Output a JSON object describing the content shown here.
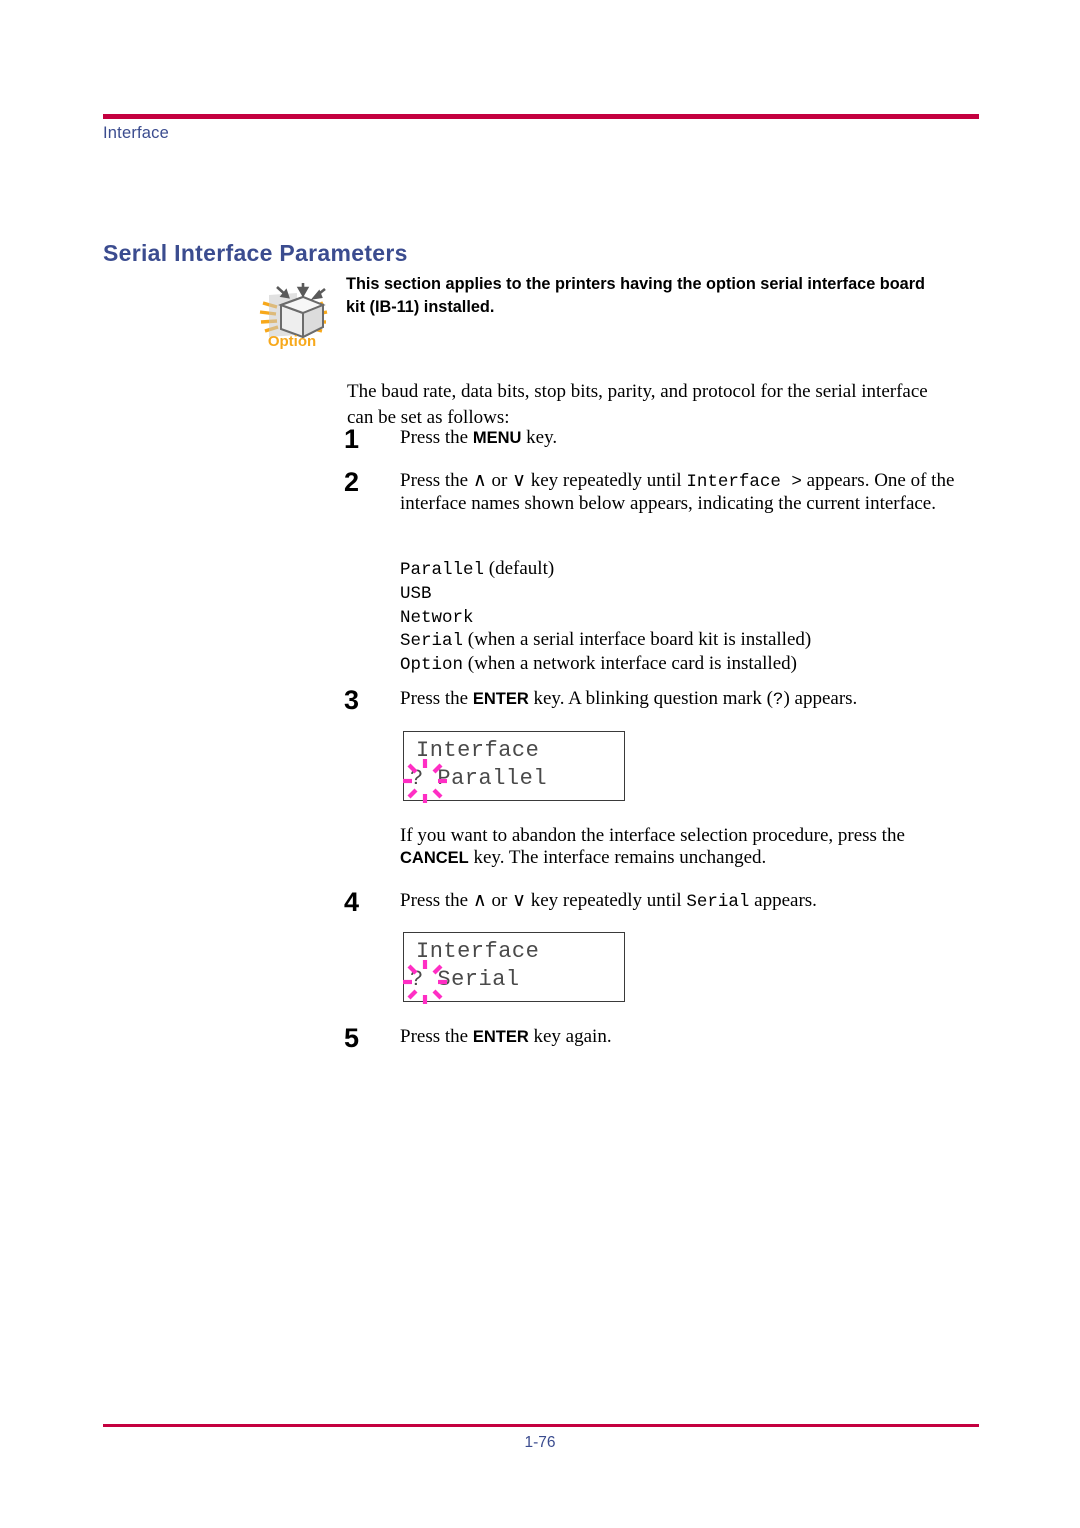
{
  "header": {
    "section_label": "Interface",
    "rule_color": "#C4003F",
    "label_color": "#3B4C8F"
  },
  "title": {
    "text": "Serial Interface Parameters",
    "color": "#3B4C8F"
  },
  "option_note": {
    "icon_name": "option-box-icon",
    "caption": "Option",
    "caption_color": "#F7A81B",
    "text": "This section applies to the printers having the option serial interface board kit (IB-11) installed."
  },
  "intro": {
    "text": "The baud rate, data bits, stop bits, parity, and protocol for the serial interface can be set as follows:"
  },
  "steps": [
    {
      "number": "1",
      "parts": [
        {
          "t": "text",
          "v": "Press the "
        },
        {
          "t": "key",
          "v": "MENU"
        },
        {
          "t": "text",
          "v": " key."
        }
      ]
    },
    {
      "number": "2",
      "parts": [
        {
          "t": "text",
          "v": "Press the "
        },
        {
          "t": "glyph",
          "v": "∧"
        },
        {
          "t": "text",
          "v": " or "
        },
        {
          "t": "glyph",
          "v": "∨"
        },
        {
          "t": "text",
          "v": " key repeatedly until "
        },
        {
          "t": "mono",
          "v": "Interface >"
        },
        {
          "t": "text",
          "v": " appears. One of the interface names shown below appears, indicating the current interface."
        }
      ]
    },
    {
      "number": "3",
      "parts": [
        {
          "t": "text",
          "v": "Press the "
        },
        {
          "t": "key",
          "v": "ENTER"
        },
        {
          "t": "text",
          "v": " key. A blinking question mark ("
        },
        {
          "t": "mono",
          "v": "?"
        },
        {
          "t": "text",
          "v": ") appears."
        }
      ]
    },
    {
      "number": "4",
      "parts": [
        {
          "t": "text",
          "v": "Press the "
        },
        {
          "t": "glyph",
          "v": "∧"
        },
        {
          "t": "text",
          "v": " or "
        },
        {
          "t": "glyph",
          "v": "∨"
        },
        {
          "t": "text",
          "v": " key repeatedly until "
        },
        {
          "t": "mono",
          "v": "Serial"
        },
        {
          "t": "text",
          "v": " appears."
        }
      ]
    },
    {
      "number": "5",
      "parts": [
        {
          "t": "text",
          "v": "Press the "
        },
        {
          "t": "key",
          "v": "ENTER"
        },
        {
          "t": "text",
          "v": " key again."
        }
      ]
    }
  ],
  "interface_list": [
    {
      "name": "Parallel",
      "note": "(default)"
    },
    {
      "name": "USB",
      "note": ""
    },
    {
      "name": "Network",
      "note": ""
    },
    {
      "name": "Serial",
      "note": "(when a serial interface board kit is installed)"
    },
    {
      "name": "Option",
      "note": "(when a network interface card is installed)"
    }
  ],
  "abandon_note": {
    "parts": [
      {
        "t": "text",
        "v": "If you want to abandon the interface selection procedure, press the "
      },
      {
        "t": "key",
        "v": "CANCEL"
      },
      {
        "t": "text",
        "v": " key. The interface remains unchanged."
      }
    ]
  },
  "lcd_panels": [
    {
      "id": "lcd-parallel",
      "line1": "Interface",
      "line2_marker": "?",
      "line2": " Parallel",
      "blink_color": "#FF2EC4"
    },
    {
      "id": "lcd-serial",
      "line1": "Interface",
      "line2_marker": "?",
      "line2": " Serial",
      "blink_color": "#FF2EC4"
    }
  ],
  "footer": {
    "page_number": "1-76",
    "rule_color": "#C4003F",
    "page_color": "#3B4C8F"
  }
}
